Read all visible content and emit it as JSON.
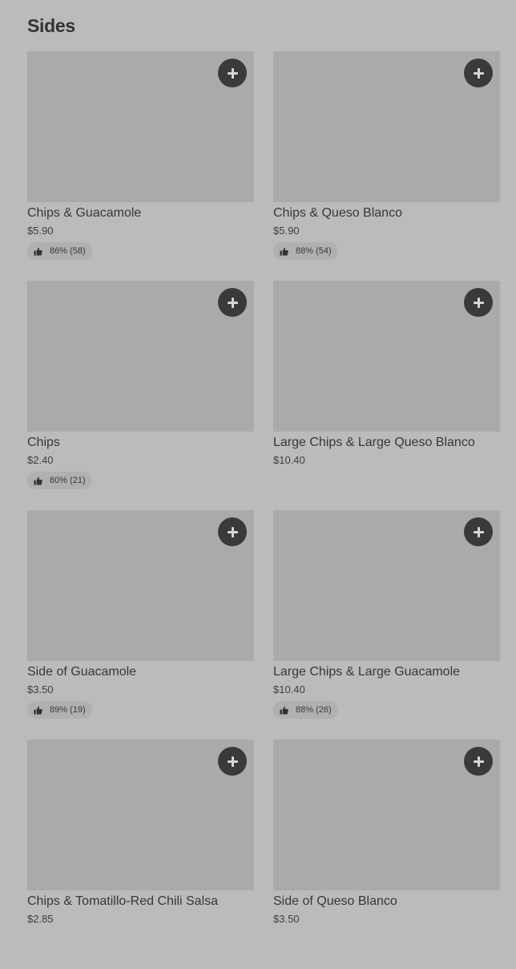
{
  "section": {
    "title": "Sides"
  },
  "items": [
    {
      "name": "Chips & Guacamole",
      "price": "$5.90",
      "rating": "86% (58)"
    },
    {
      "name": "Chips & Queso Blanco",
      "price": "$5.90",
      "rating": "88% (54)"
    },
    {
      "name": "Chips",
      "price": "$2.40",
      "rating": "80% (21)"
    },
    {
      "name": "Large Chips & Large Queso Blanco",
      "price": "$10.40",
      "rating": null
    },
    {
      "name": "Side of Guacamole",
      "price": "$3.50",
      "rating": "89% (19)"
    },
    {
      "name": "Large Chips & Large Guacamole",
      "price": "$10.40",
      "rating": "88% (26)"
    },
    {
      "name": "Chips & Tomatillo-Red Chili Salsa",
      "price": "$2.85",
      "rating": null
    },
    {
      "name": "Side of Queso Blanco",
      "price": "$3.50",
      "rating": null
    }
  ],
  "icons": {
    "add": "plus-icon",
    "rating": "thumbs-up-icon"
  },
  "colors": {
    "background": "#bbbbbb",
    "image_placeholder": "#aaaaaa",
    "add_button": "#3a3a3a",
    "rating_pill": "#b0b0b0"
  }
}
